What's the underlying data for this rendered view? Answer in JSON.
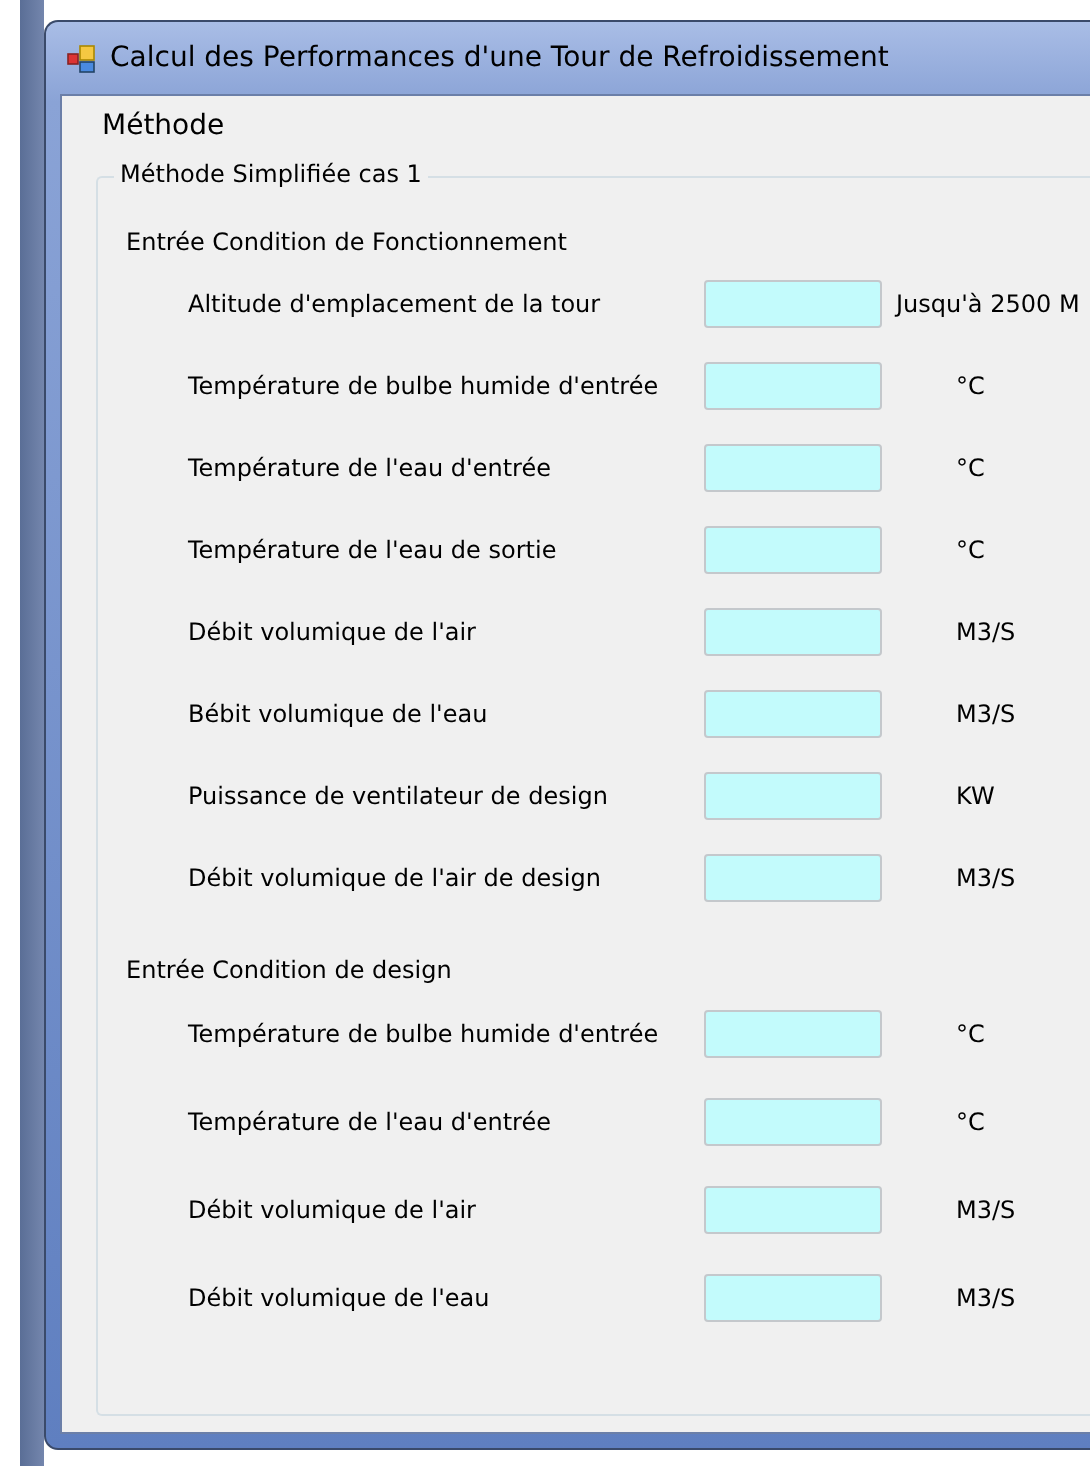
{
  "window": {
    "title": "Calcul des Performances d'une Tour de Refroidissement"
  },
  "menu": [
    "Méthode"
  ],
  "group": {
    "title": "Méthode Simplifiée cas 1",
    "sections": [
      {
        "title": "Entrée Condition de Fonctionnement",
        "rows": [
          {
            "label": "Altitude d'emplacement de la tour",
            "kind": "range",
            "unit": "Jusqu'à 2500 M"
          },
          {
            "label": "Température de bulbe humide d'entrée",
            "kind": "unit",
            "unit": "°C"
          },
          {
            "label": "Température de l'eau d'entrée",
            "kind": "unit",
            "unit": "°C"
          },
          {
            "label": "Température de l'eau de sortie",
            "kind": "unit",
            "unit": "°C"
          },
          {
            "label": "Débit volumique de l'air",
            "kind": "unit",
            "unit": "M3/S"
          },
          {
            "label": "Bébit volumique de l'eau",
            "kind": "unit",
            "unit": "M3/S"
          },
          {
            "label": "Puissance de ventilateur de design",
            "kind": "unit",
            "unit": "KW"
          },
          {
            "label": "Débit volumique de l'air de design",
            "kind": "unit",
            "unit": "M3/S"
          }
        ]
      },
      {
        "title": "Entrée Condition de design",
        "rows": [
          {
            "label": "Température de bulbe humide d'entrée",
            "kind": "unit",
            "unit": "°C"
          },
          {
            "label": "Température de l'eau d'entrée",
            "kind": "unit",
            "unit": "°C"
          },
          {
            "label": "Débit volumique de l'air",
            "kind": "unit",
            "unit": "M3/S"
          },
          {
            "label": "Débit volumique de l'eau",
            "kind": "unit",
            "unit": "M3/S"
          }
        ]
      }
    ]
  }
}
